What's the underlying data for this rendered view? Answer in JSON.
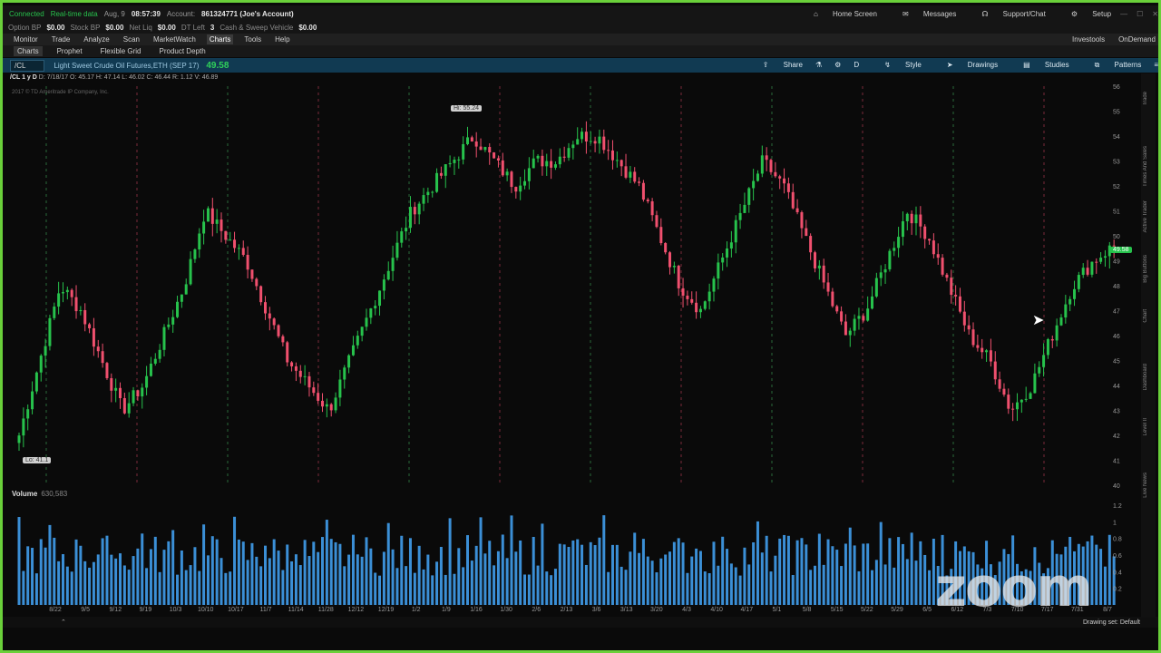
{
  "status": {
    "connected": "Connected",
    "realtime": "Real-time data",
    "date": "Aug, 9",
    "time": "08:57:39",
    "account_label": "Account:",
    "account": "861324771 (Joe's Account)",
    "home": "Home Screen",
    "messages": "Messages",
    "support": "Support/Chat",
    "setup": "Setup"
  },
  "buying_power": [
    {
      "label": "Option BP",
      "value": "$0.00"
    },
    {
      "label": "Stock BP",
      "value": "$0.00"
    },
    {
      "label": "Net Liq",
      "value": "$0.00"
    },
    {
      "label": "DT Left",
      "value": "3"
    },
    {
      "label": "Cash & Sweep Vehicle",
      "value": "$0.00"
    }
  ],
  "menu": [
    "Monitor",
    "Trade",
    "Analyze",
    "Scan",
    "MarketWatch",
    "Charts",
    "Tools",
    "Help"
  ],
  "menu_right": [
    "Investools",
    "OnDemand"
  ],
  "subtabs": [
    "Charts",
    "Prophet",
    "Flexible Grid",
    "Product Depth"
  ],
  "toolbar": {
    "symbol": "/CL",
    "description": "Light Sweet Crude Oil Futures,ETH (SEP 17)",
    "last": "49.58",
    "share": "Share",
    "style": "Style",
    "drawings": "Drawings",
    "studies": "Studies",
    "patterns": "Patterns",
    "period": "D"
  },
  "ohlc": {
    "symbol": "/CL 1 y D",
    "date": "D: 7/18/17",
    "open": "O: 45.17",
    "high": "H: 47.14",
    "low": "L: 46.02",
    "close": "C: 46.44",
    "range": "R: 1.12",
    "hl2": "V: 46.89"
  },
  "copyright": "2017 © TD Ameritrade IP Company, Inc.",
  "hi_tag": "Hi: 55.24",
  "lo_tag": "Lo: 41.1",
  "price_tag": "49.58",
  "volume_label": "Volume",
  "volume_value": "630,583",
  "zoom_watermark": "zoom",
  "drawing_set": "Drawing set: Default",
  "sidebar_tabs": [
    "Trade",
    "Times And Sales",
    "Active Trader",
    "Big Buttons",
    "Chart",
    "Dashboard",
    "Level II",
    "Live News"
  ],
  "colors": {
    "accent_border": "#6ad03a",
    "up": "#27c24c",
    "down": "#f0506e",
    "volume": "#3b8fd6",
    "toolbar": "#113a52"
  },
  "chart_data": {
    "type": "candlestick",
    "period": "1 y D",
    "ylim": [
      40,
      56
    ],
    "y_ticks": [
      40,
      41,
      42,
      43,
      44,
      45,
      46,
      47,
      48,
      49,
      50,
      51,
      52,
      53,
      54,
      55,
      56
    ],
    "x_ticks": [
      "8/22",
      "9/5",
      "9/12",
      "9/19",
      "10/3",
      "10/10",
      "10/17",
      "11/7",
      "11/14",
      "11/28",
      "12/12",
      "12/19",
      "1/2",
      "1/9",
      "1/16",
      "1/30",
      "2/6",
      "2/13",
      "3/6",
      "3/13",
      "3/20",
      "4/3",
      "4/10",
      "4/17",
      "5/1",
      "5/8",
      "5/15",
      "5/22",
      "5/29",
      "6/5",
      "6/12",
      "7/3",
      "7/10",
      "7/17",
      "7/31",
      "8/7"
    ],
    "close_path": [
      42,
      45,
      48,
      47,
      45,
      43,
      44,
      46,
      48,
      51,
      50,
      49,
      47,
      45,
      44,
      43,
      45,
      47,
      49,
      51,
      52,
      53,
      54,
      53,
      52,
      53,
      53,
      54,
      54,
      53,
      52,
      50,
      48,
      47,
      49,
      51,
      53,
      52,
      50,
      48,
      46,
      47,
      49,
      51,
      50,
      48,
      46,
      45,
      43,
      44,
      46,
      48,
      49,
      49.6
    ],
    "high": 55.24,
    "low": 41.1,
    "last": 49.58,
    "volume_ylim": [
      0,
      1.2
    ]
  }
}
